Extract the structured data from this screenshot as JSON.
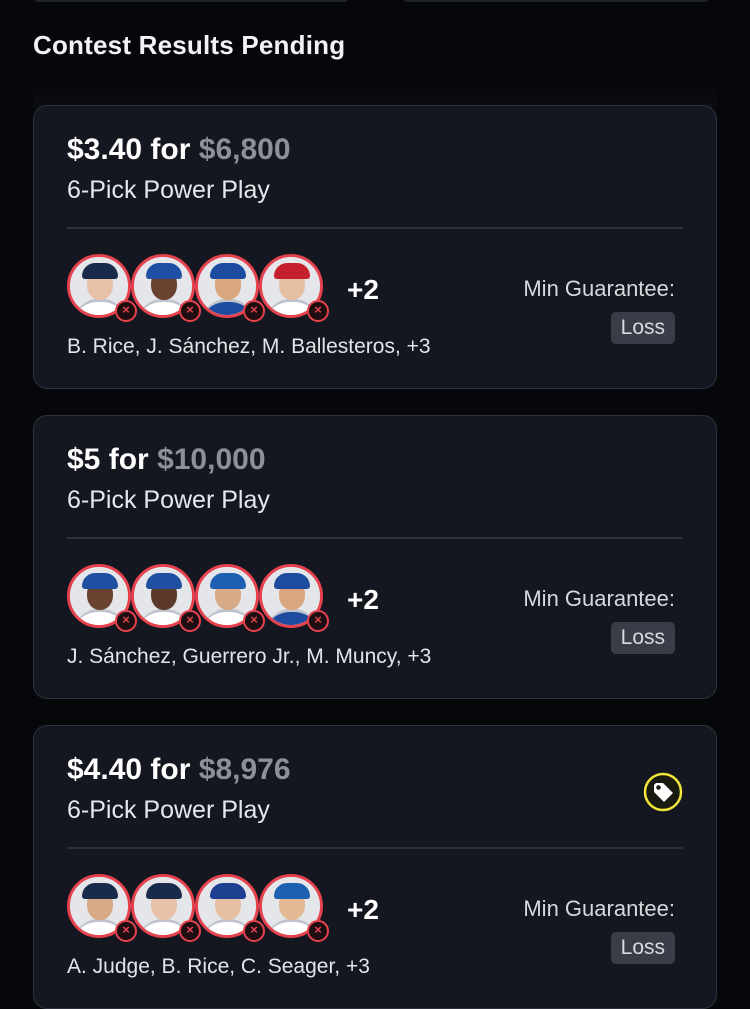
{
  "section": {
    "title": "Contest Results Pending"
  },
  "colors": {
    "loss_red": "#e5424d",
    "payout_gray": "#8d9099",
    "tag_yellow": "#f2e43a",
    "card_bg": "#141620"
  },
  "cards": [
    {
      "entry": "$3.40",
      "for_word": "for",
      "payout": "$6,800",
      "play_type": "6-Pick Power Play",
      "more_count": "+2",
      "names": "B. Rice, J. Sánchez, M. Ballesteros, +3",
      "min_label": "Min Guarantee:",
      "result": "Loss",
      "has_tag_icon": false,
      "players": [
        {
          "team": "NYY",
          "cap": "#1a2a4a",
          "skin": "#e8c2a8",
          "jersey": "#ffffff"
        },
        {
          "team": "TOR",
          "cap": "#1e4fa3",
          "skin": "#6a4330",
          "jersey": "#ffffff"
        },
        {
          "team": "CHC",
          "cap": "#1d4ba0",
          "skin": "#d9a67f",
          "jersey": "#1d4ba0"
        },
        {
          "team": "CIN",
          "cap": "#c6202d",
          "skin": "#e6bfa2",
          "jersey": "#ffffff"
        }
      ]
    },
    {
      "entry": "$5",
      "for_word": "for",
      "payout": "$10,000",
      "play_type": "6-Pick Power Play",
      "more_count": "+2",
      "names": "J. Sánchez, Guerrero Jr., M. Muncy, +3",
      "min_label": "Min Guarantee:",
      "result": "Loss",
      "has_tag_icon": false,
      "players": [
        {
          "team": "TOR",
          "cap": "#1e4fa3",
          "skin": "#6a4330",
          "jersey": "#ffffff"
        },
        {
          "team": "TOR",
          "cap": "#1e4fa3",
          "skin": "#5b3a2a",
          "jersey": "#ffffff"
        },
        {
          "team": "LAD",
          "cap": "#1d5fb0",
          "skin": "#d8a987",
          "jersey": "#ffffff"
        },
        {
          "team": "CHC",
          "cap": "#1d4ba0",
          "skin": "#d9a67f",
          "jersey": "#1d4ba0"
        }
      ]
    },
    {
      "entry": "$4.40",
      "for_word": "for",
      "payout": "$8,976",
      "play_type": "6-Pick Power Play",
      "more_count": "+2",
      "names": "A. Judge, B. Rice, C. Seager, +3",
      "min_label": "Min Guarantee:",
      "result": "Loss",
      "has_tag_icon": true,
      "tag_icon": "price-tag-icon",
      "players": [
        {
          "team": "NYY",
          "cap": "#1a2a4a",
          "skin": "#d8a987",
          "jersey": "#ffffff"
        },
        {
          "team": "NYY",
          "cap": "#1a2a4a",
          "skin": "#e8c2a8",
          "jersey": "#ffffff"
        },
        {
          "team": "TEX",
          "cap": "#1e3f8f",
          "skin": "#e6bfa2",
          "jersey": "#ffffff"
        },
        {
          "team": "LAD",
          "cap": "#1d5fb0",
          "skin": "#e3b995",
          "jersey": "#ffffff"
        }
      ]
    }
  ]
}
